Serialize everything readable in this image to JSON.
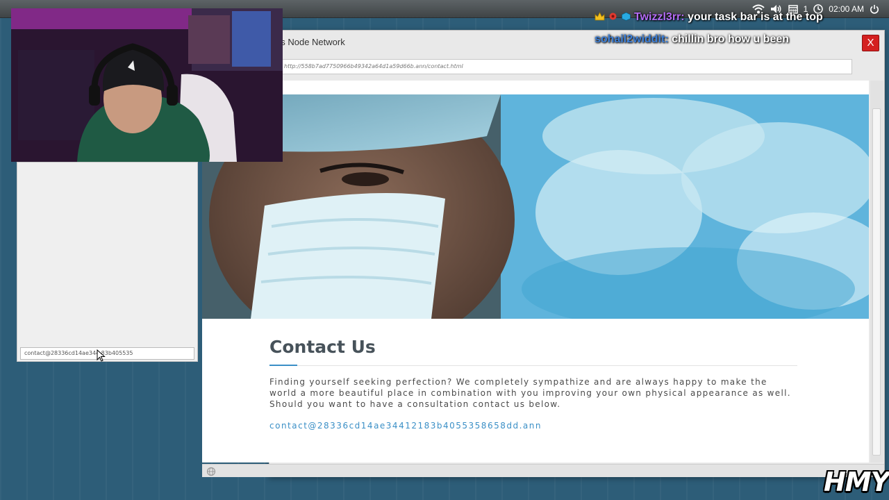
{
  "taskbar": {
    "icons": [
      "wifi-icon",
      "volume-icon",
      "calendar-icon",
      "clock-icon",
      "power-icon"
    ],
    "notification_count": "1",
    "time": "02:00 AM"
  },
  "chat": [
    {
      "user": "Twizzl3rr:",
      "message": "your task bar is at the top",
      "color": "#b46cf5"
    },
    {
      "user": "sohail2widdit:",
      "message": "chillin bro how u been",
      "color": "#3c7fd8"
    }
  ],
  "side_panel": {
    "field_value": "contact@28336cd14ae344 83b405535"
  },
  "window": {
    "title": "us Node Network",
    "close_label": "X",
    "url": "http://558b7ad7750966b49342a64d1a59d66b.ann/contact.html"
  },
  "page": {
    "heading": "Contact Us",
    "body": "Finding yourself seeking perfection? We completely sympathize and are always happy to make the world a more beautiful place in combination with you improving your own physical appearance as well. Should you want to have a consultation contact us below.",
    "email": "contact@28336cd14ae34412183b4055358658dd.ann"
  },
  "watermark": "HMY",
  "colors": {
    "accent": "#3a8fc6",
    "close_button": "#d42020",
    "heading": "#47525a",
    "desktop": "#2d5d78"
  }
}
